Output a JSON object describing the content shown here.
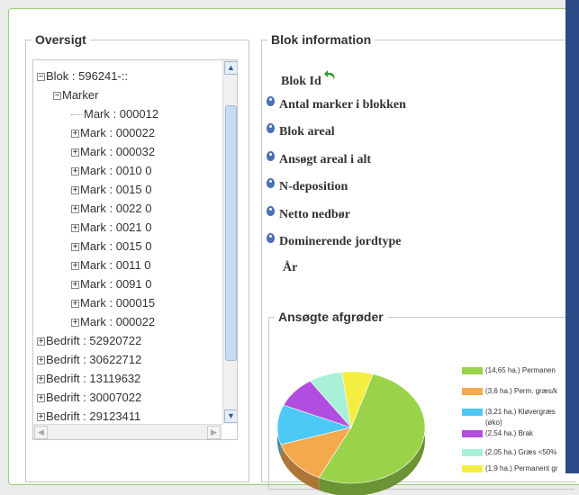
{
  "oversigt": {
    "legend": "Oversigt",
    "tree": [
      {
        "label": "Blok : 596241-::",
        "level": 0,
        "toggle": "−"
      },
      {
        "label": "Marker",
        "level": 1,
        "toggle": "−"
      },
      {
        "label": "Mark : 000012",
        "level": 2,
        "toggle": ""
      },
      {
        "label": "Mark : 000022",
        "level": 2,
        "toggle": "+"
      },
      {
        "label": "Mark : 000032",
        "level": 2,
        "toggle": "+"
      },
      {
        "label": "Mark : 0010 0",
        "level": 2,
        "toggle": "+"
      },
      {
        "label": "Mark : 0015 0",
        "level": 2,
        "toggle": "+"
      },
      {
        "label": "Mark : 0022 0",
        "level": 2,
        "toggle": "+"
      },
      {
        "label": "Mark : 0021 0",
        "level": 2,
        "toggle": "+"
      },
      {
        "label": "Mark : 0015 0",
        "level": 2,
        "toggle": "+"
      },
      {
        "label": "Mark : 0011 0",
        "level": 2,
        "toggle": "+"
      },
      {
        "label": "Mark : 0091 0",
        "level": 2,
        "toggle": "+"
      },
      {
        "label": "Mark : 000015",
        "level": 2,
        "toggle": "+"
      },
      {
        "label": "Mark : 000022",
        "level": 2,
        "toggle": "+"
      },
      {
        "label": "Bedrift : 52920722",
        "level": 0,
        "toggle": "+"
      },
      {
        "label": "Bedrift : 30622712",
        "level": 0,
        "toggle": "+"
      },
      {
        "label": "Bedrift : 13119632",
        "level": 0,
        "toggle": "+"
      },
      {
        "label": "Bedrift : 30007022",
        "level": 0,
        "toggle": "+"
      },
      {
        "label": "Bedrift : 29123411",
        "level": 0,
        "toggle": "+"
      }
    ]
  },
  "blok_information": {
    "legend": "Blok information",
    "blok_id": "Blok Id",
    "rows": [
      "Antal marker i blokken",
      "Blok areal",
      "Ansøgt areal i alt",
      "N-deposition",
      "Netto nedbør",
      "Dominerende jordtype"
    ],
    "aar": "År"
  },
  "afgroeder": {
    "legend": "Ansøgte afgrøder",
    "legend_items": [
      {
        "text": "(14,65 ha.) Permanen",
        "color": "#9ad24a"
      },
      {
        "text": "(3,6 ha.) Perm. græs/k",
        "color": "#f5a94d"
      },
      {
        "text": "(3,21 ha.) Kløvergræs",
        "text2": "(øko)",
        "color": "#4cc8f5"
      },
      {
        "text": "(2,54 ha.) Brak",
        "color": "#b14ee0"
      },
      {
        "text": "(2,05 ha.) Græs <50%",
        "color": "#a8f0d8"
      },
      {
        "text": "(1,9 ha.) Permanent gr",
        "color": "#f5ee42"
      }
    ]
  },
  "chart_data": {
    "type": "pie",
    "title": "Ansøgte afgrøder",
    "categories": [
      "(14,65 ha.) Permanen",
      "(3,6 ha.) Perm. græs/k",
      "(3,21 ha.) Kløvergræs (øko)",
      "(2,54 ha.) Brak",
      "(2,05 ha.) Græs <50%",
      "(1,9 ha.) Permanent gr"
    ],
    "values": [
      14.65,
      3.6,
      3.21,
      2.54,
      2.05,
      1.9
    ],
    "colors": [
      "#9ad24a",
      "#f5a94d",
      "#4cc8f5",
      "#b14ee0",
      "#a8f0d8",
      "#f5ee42"
    ]
  }
}
